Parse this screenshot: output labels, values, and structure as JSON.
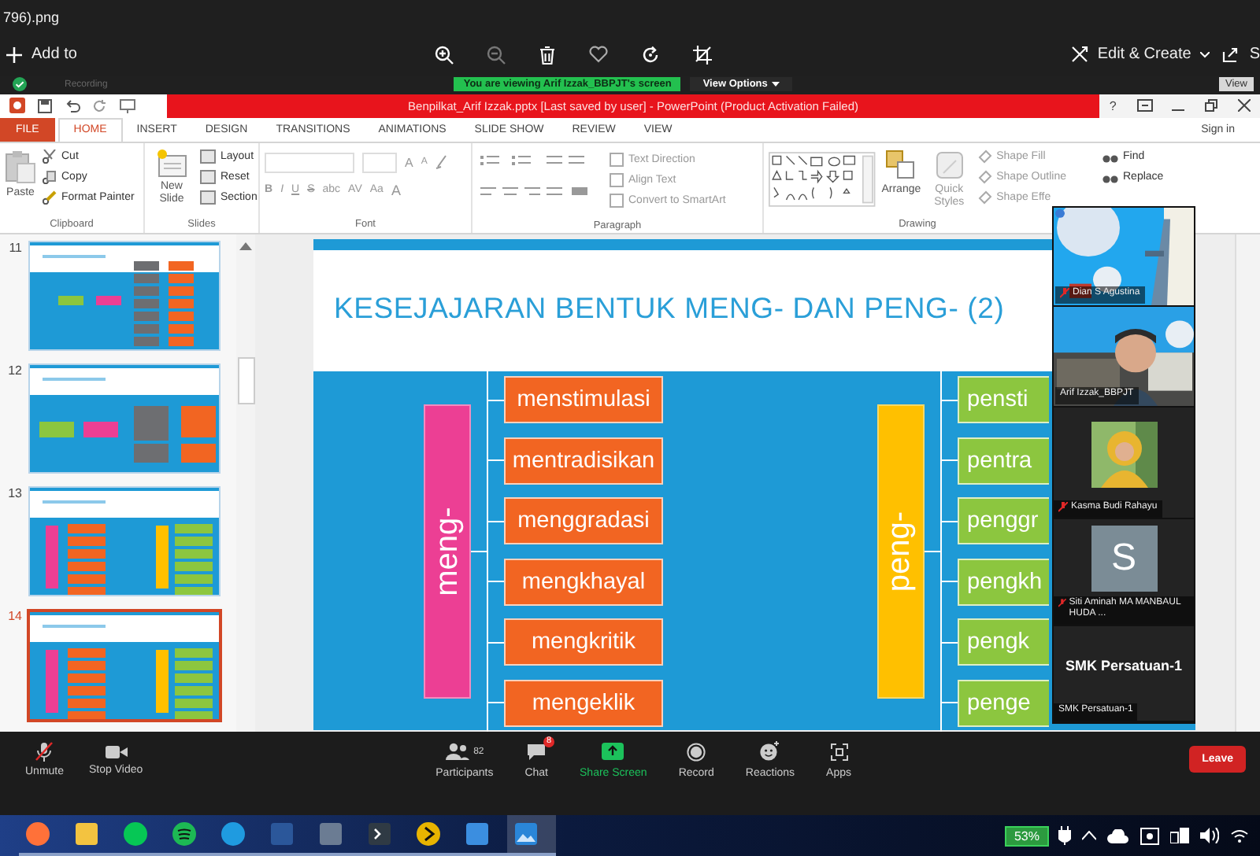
{
  "viewer": {
    "file_title": "796).png",
    "add_to": "Add to",
    "edit_create": "Edit & Create",
    "share": "S"
  },
  "meeting_banner": {
    "recording": "Recording",
    "viewing": "You are viewing Arif Izzak_BBPJT's screen",
    "view_options": "View Options",
    "view": "View"
  },
  "powerpoint": {
    "title": "Benpilkat_Arif Izzak.pptx [Last saved by user]  -  PowerPoint (Product Activation Failed)",
    "help": "?",
    "tabs": [
      {
        "label": "FILE",
        "kind": "file",
        "selected": false
      },
      {
        "label": "HOME",
        "kind": "tab",
        "selected": true
      },
      {
        "label": "INSERT",
        "kind": "tab",
        "selected": false
      },
      {
        "label": "DESIGN",
        "kind": "tab",
        "selected": false
      },
      {
        "label": "TRANSITIONS",
        "kind": "tab",
        "selected": false
      },
      {
        "label": "ANIMATIONS",
        "kind": "tab",
        "selected": false
      },
      {
        "label": "SLIDE SHOW",
        "kind": "tab",
        "selected": false
      },
      {
        "label": "REVIEW",
        "kind": "tab",
        "selected": false
      },
      {
        "label": "VIEW",
        "kind": "tab",
        "selected": false
      }
    ],
    "sign_in": "Sign in",
    "ribbon": {
      "clipboard": {
        "label": "Clipboard",
        "paste": "Paste",
        "items": [
          "Cut",
          "Copy",
          "Format Painter"
        ]
      },
      "slides": {
        "label": "Slides",
        "new_slide": "New Slide",
        "items": [
          "Layout",
          "Reset",
          "Section"
        ]
      },
      "font": {
        "label": "Font",
        "grow": [
          "A",
          "A"
        ],
        "tools": [
          "B",
          "I",
          "U",
          "S",
          "abc",
          "AV",
          "Aa",
          "A"
        ]
      },
      "paragraph": {
        "label": "Paragraph",
        "items": [
          "Text Direction",
          "Align Text",
          "Convert to SmartArt"
        ]
      },
      "drawing": {
        "label": "Drawing",
        "arrange": "Arrange",
        "quick_styles": "Quick Styles",
        "items": [
          "Shape Fill",
          "Shape Outline",
          "Shape Effe"
        ]
      },
      "editing": {
        "items": [
          "Find",
          "Replace"
        ]
      }
    }
  },
  "thumbnails": [
    {
      "number": "11",
      "kind": "tree",
      "selected": false
    },
    {
      "number": "12",
      "kind": "flow",
      "selected": false
    },
    {
      "number": "13",
      "kind": "columns",
      "selected": false
    },
    {
      "number": "14",
      "kind": "columns",
      "selected": true
    }
  ],
  "slide": {
    "title": "KESEJAJARAN BENTUK MENG- DAN PENG- (2)",
    "groups": [
      {
        "label": "meng-",
        "color": "#ec3f94",
        "items": [
          "menstimulasi",
          "mentradisikan",
          "menggradasi",
          "mengkhayal",
          "mengkritik",
          "mengeklik"
        ]
      },
      {
        "label": "peng-",
        "color": "#ffc000",
        "items": [
          "pensti",
          "pentra",
          "penggr",
          "pengkh",
          "pengk",
          "penge"
        ]
      }
    ]
  },
  "participants": [
    {
      "name": "Dian S Agustina",
      "kind": "video",
      "muted": true
    },
    {
      "name": "Arif Izzak_BBPJT",
      "kind": "video2",
      "muted": false
    },
    {
      "name": "Kasma Budi Rahayu",
      "muted": true
    },
    {
      "name": "Siti Aminah MA MANBAUL HUDA ...",
      "kind": "initial",
      "initial": "S",
      "muted": true
    },
    {
      "name": "SMK Persatuan-1",
      "kind": "name",
      "display": "SMK Persatuan-1",
      "muted": false
    }
  ],
  "controls_left": [
    {
      "label": "Unmute",
      "kind": "mic_off"
    },
    {
      "label": "Stop Video",
      "kind": "video"
    }
  ],
  "controls_center": [
    {
      "label": "Participants",
      "kind": "participants",
      "count": "82"
    },
    {
      "label": "Chat",
      "kind": "chat",
      "badge": "8"
    },
    {
      "label": "Share Screen",
      "kind": "share"
    },
    {
      "label": "Record",
      "kind": "record"
    },
    {
      "label": "Reactions",
      "kind": "reactions"
    },
    {
      "label": "Apps",
      "kind": "apps"
    }
  ],
  "leave": "Leave",
  "taskbar": {
    "apps": [
      {
        "kind": "firefox",
        "selected": false
      },
      {
        "kind": "files",
        "selected": false
      },
      {
        "kind": "line",
        "selected": false
      },
      {
        "kind": "spotify",
        "selected": false
      },
      {
        "kind": "edge",
        "selected": false
      },
      {
        "kind": "word",
        "selected": false
      },
      {
        "kind": "calculator",
        "selected": false
      },
      {
        "kind": "terminal",
        "selected": false
      },
      {
        "kind": "player",
        "selected": false
      },
      {
        "kind": "search",
        "selected": false
      },
      {
        "kind": "photos",
        "selected": true
      }
    ],
    "battery": "53%"
  }
}
